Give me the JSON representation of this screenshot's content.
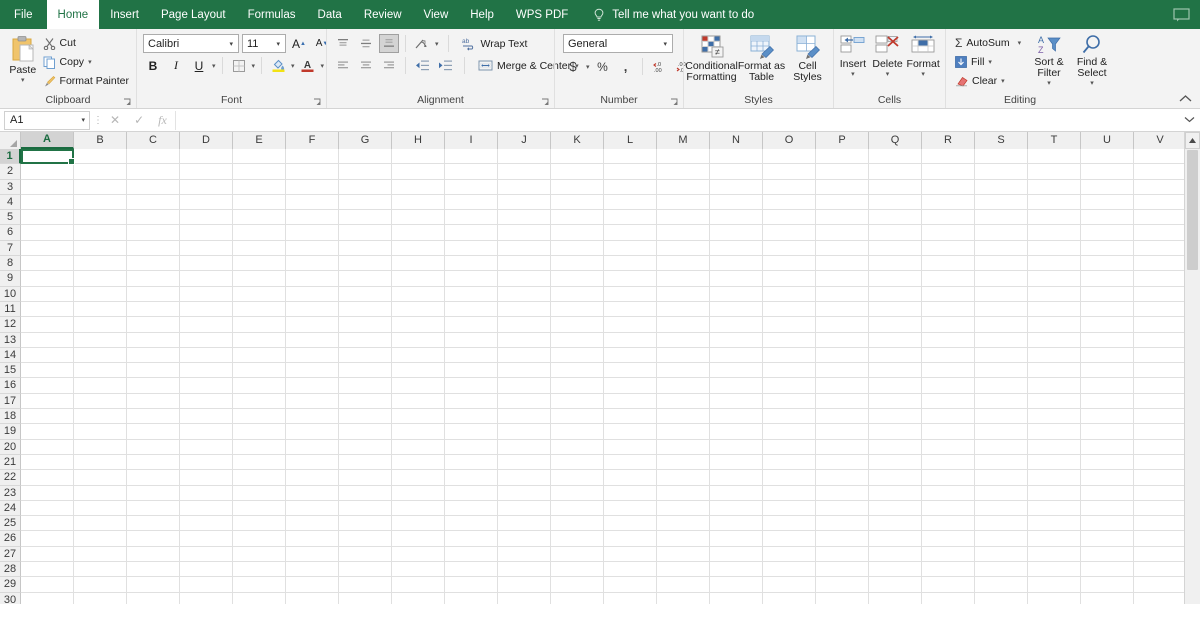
{
  "app": {
    "accent_green": "#217346",
    "ribbon_bg": "#f3f3f3"
  },
  "tabs": [
    {
      "label": "File",
      "active": false
    },
    {
      "label": "Home",
      "active": true
    },
    {
      "label": "Insert",
      "active": false
    },
    {
      "label": "Page Layout",
      "active": false
    },
    {
      "label": "Formulas",
      "active": false
    },
    {
      "label": "Data",
      "active": false
    },
    {
      "label": "Review",
      "active": false
    },
    {
      "label": "View",
      "active": false
    },
    {
      "label": "Help",
      "active": false
    },
    {
      "label": "WPS PDF",
      "active": false
    }
  ],
  "tellme": {
    "label": "Tell me what you want to do",
    "icon": "lightbulb-icon"
  },
  "presence_icon": "comments-icon",
  "ribbon": {
    "collapse_icon": "chevron-up-icon",
    "groups": {
      "clipboard": {
        "label": "Clipboard",
        "paste": {
          "label": "Paste",
          "icon": "paste-icon"
        },
        "cut": {
          "label": "Cut",
          "icon": "scissors-icon"
        },
        "copy": {
          "label": "Copy",
          "icon": "copy-icon"
        },
        "format_painter": {
          "label": "Format Painter",
          "icon": "paintbrush-icon"
        }
      },
      "font": {
        "label": "Font",
        "font_family": "Calibri",
        "font_size": "11",
        "grow_font": "A",
        "shrink_font": "A",
        "bold": "B",
        "italic": "I",
        "underline": "U",
        "borders_icon": "borders-icon",
        "fill_color_icon": "fill-color-icon",
        "font_color_icon": "font-color-icon"
      },
      "alignment": {
        "label": "Alignment",
        "align_top_icon": "align-top-icon",
        "align_middle_icon": "align-middle-icon",
        "align_bottom_icon": "align-bottom-icon",
        "orientation_icon": "orientation-icon",
        "align_left_icon": "align-left-icon",
        "align_center_icon": "align-center-icon",
        "align_right_icon": "align-right-icon",
        "decrease_indent_icon": "decrease-indent-icon",
        "increase_indent_icon": "increase-indent-icon",
        "wrap_text": "Wrap Text",
        "merge_center": "Merge & Center"
      },
      "number": {
        "label": "Number",
        "format": "General",
        "accounting": "$",
        "percent": "%",
        "comma": ",",
        "increase_decimal_icon": "increase-decimal-icon",
        "decrease_decimal_icon": "decrease-decimal-icon"
      },
      "styles": {
        "label": "Styles",
        "conditional_formatting": "Conditional Formatting",
        "format_as_table": "Format as Table",
        "cell_styles": "Cell Styles"
      },
      "cells": {
        "label": "Cells",
        "insert": "Insert",
        "delete": "Delete",
        "format": "Format"
      },
      "editing": {
        "label": "Editing",
        "autosum": "AutoSum",
        "fill": "Fill",
        "clear": "Clear",
        "sort_filter": "Sort & Filter",
        "find_select": "Find & Select"
      }
    }
  },
  "formula_bar": {
    "name_box": "A1",
    "cancel_icon": "cancel-x-icon",
    "enter_icon": "check-icon",
    "function_icon": "fx-icon",
    "value": "",
    "placeholder": "",
    "expand_icon": "chevron-down-icon"
  },
  "grid": {
    "columns": [
      "A",
      "B",
      "C",
      "D",
      "E",
      "F",
      "G",
      "H",
      "I",
      "J",
      "K",
      "L",
      "M",
      "N",
      "O",
      "P",
      "Q",
      "R",
      "S",
      "T",
      "U",
      "V"
    ],
    "selected_column": "A",
    "rows": [
      1,
      2,
      3,
      4,
      5,
      6,
      7,
      8,
      9,
      10,
      11,
      12,
      13,
      14,
      15,
      16,
      17,
      18,
      19,
      20,
      21,
      22,
      23,
      24,
      25,
      26,
      27,
      28,
      29,
      30
    ],
    "selected_row": 1,
    "active_cell": "A1",
    "active_cell_value": ""
  },
  "scrollbar": {
    "up_arrow_icon": "caret-up-icon"
  }
}
